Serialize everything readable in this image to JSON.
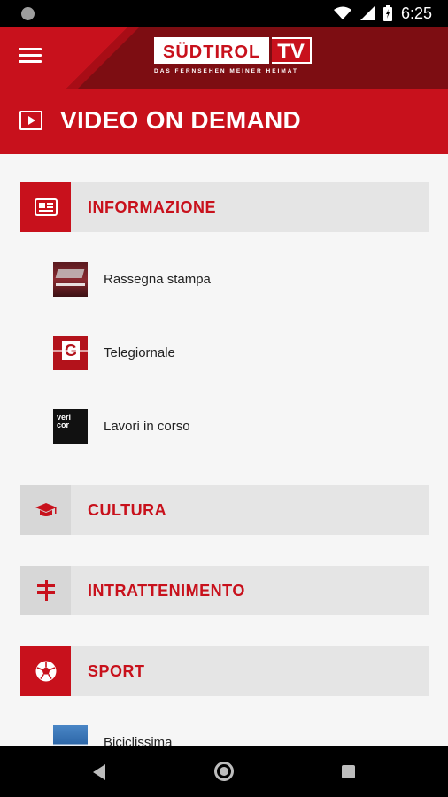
{
  "status_bar": {
    "time": "6:25",
    "icons": [
      "wifi-icon",
      "signal-icon",
      "battery-icon"
    ]
  },
  "app_bar": {
    "menu_icon": "menu-icon",
    "logo_main": "SÜDTIROL",
    "logo_tv": "TV",
    "logo_tagline": "DAS FERNSEHEN MEINER HEIMAT"
  },
  "header": {
    "title": "VIDEO ON DEMAND",
    "icon": "play-icon"
  },
  "categories": [
    {
      "label": "INFORMAZIONE",
      "icon": "newspaper-icon",
      "expanded": true,
      "items": [
        {
          "label": "Rassegna stampa"
        },
        {
          "label": "Telegiornale"
        },
        {
          "label": "Lavori in corso",
          "thumb_text": "veri\ncor"
        }
      ]
    },
    {
      "label": "CULTURA",
      "icon": "graduation-cap-icon",
      "expanded": false
    },
    {
      "label": "INTRATTENIMENTO",
      "icon": "signpost-icon",
      "expanded": false
    },
    {
      "label": "SPORT",
      "icon": "soccer-ball-icon",
      "expanded": true,
      "items": [
        {
          "label": "Biciclissima"
        }
      ]
    }
  ],
  "colors": {
    "brand_red": "#c8111c",
    "dark_red": "#7d0d12",
    "category_bg": "#e5e5e5",
    "background": "#f6f6f6"
  }
}
